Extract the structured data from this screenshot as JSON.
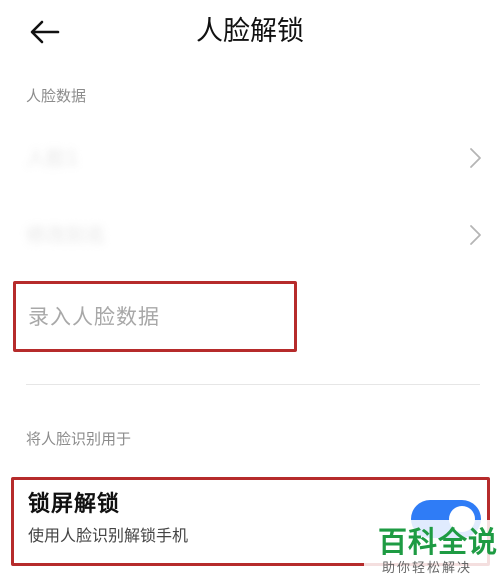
{
  "header": {
    "title": "人脸解锁",
    "back_icon": "arrow-left-icon"
  },
  "face_data": {
    "section_label": "人脸数据",
    "items": [
      {
        "label": "人脸1",
        "icon": "chevron-right-icon"
      },
      {
        "label": "修改别名",
        "icon": "chevron-right-icon"
      }
    ],
    "enroll_label": "录入人脸数据"
  },
  "usage": {
    "section_label": "将人脸识别用于",
    "lock_screen": {
      "title": "锁屏解锁",
      "description": "使用人脸识别解锁手机",
      "enabled": true,
      "toggle_color": "#2f7cf6"
    }
  },
  "watermark": {
    "title": "百科全说",
    "subtitle": "助你轻松解决"
  },
  "colors": {
    "highlight": "#b62b2b",
    "accent": "#2f7cf6",
    "watermark_green": "#1e9b43"
  }
}
